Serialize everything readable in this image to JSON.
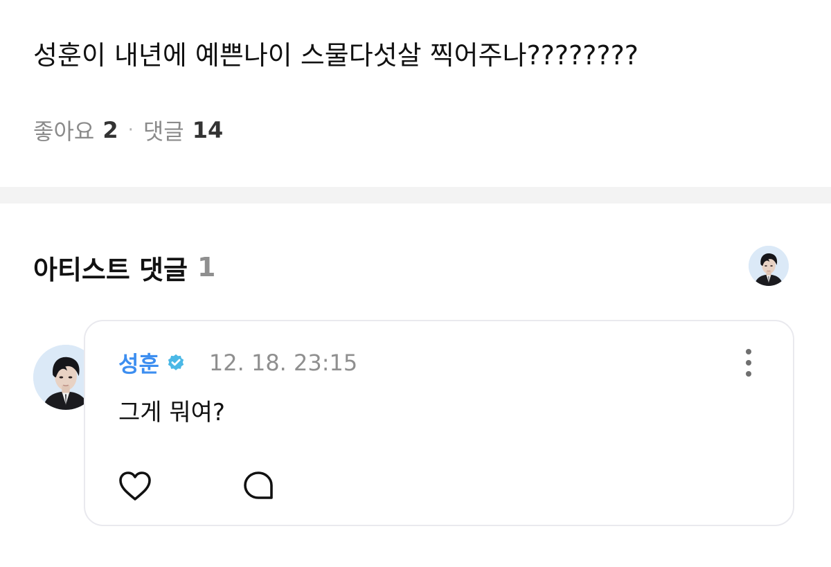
{
  "post": {
    "text": "성훈이 내년에 예쁜나이 스물다섯살 찍어주나????????"
  },
  "stats": {
    "likes_label": "좋아요",
    "likes_count": "2",
    "separator": "·",
    "comments_label": "댓글",
    "comments_count": "14"
  },
  "artist_comments": {
    "title": "아티스트 댓글",
    "count": "1"
  },
  "comment": {
    "author": "성훈",
    "timestamp": "12. 18. 23:15",
    "text": "그게 뭐여?"
  },
  "icons": {
    "verified": "verified-badge-icon",
    "more": "more-vertical-icon",
    "like": "heart-icon",
    "reply": "speech-bubble-icon"
  },
  "colors": {
    "author": "#3d8ef0",
    "verified_badge": "#4bb8e6",
    "muted_text": "#8f8f8f",
    "divider": "#f3f3f3",
    "card_border": "#e9e9ee"
  }
}
